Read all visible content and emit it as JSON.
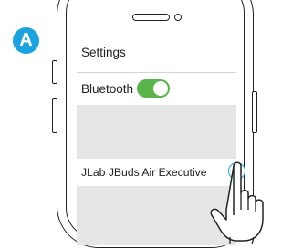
{
  "badge": {
    "letter": "A",
    "color": "#1aa3df"
  },
  "screen": {
    "title": "Settings",
    "bluetooth": {
      "label": "Bluetooth",
      "toggle_on": true,
      "toggle_color": "#59b44a"
    },
    "device": {
      "name": "JLab JBuds Air Executive",
      "info_icon": "info-icon",
      "info_glyph": "i"
    }
  },
  "illustration": {
    "hand_icon": "pointing-hand-icon"
  }
}
